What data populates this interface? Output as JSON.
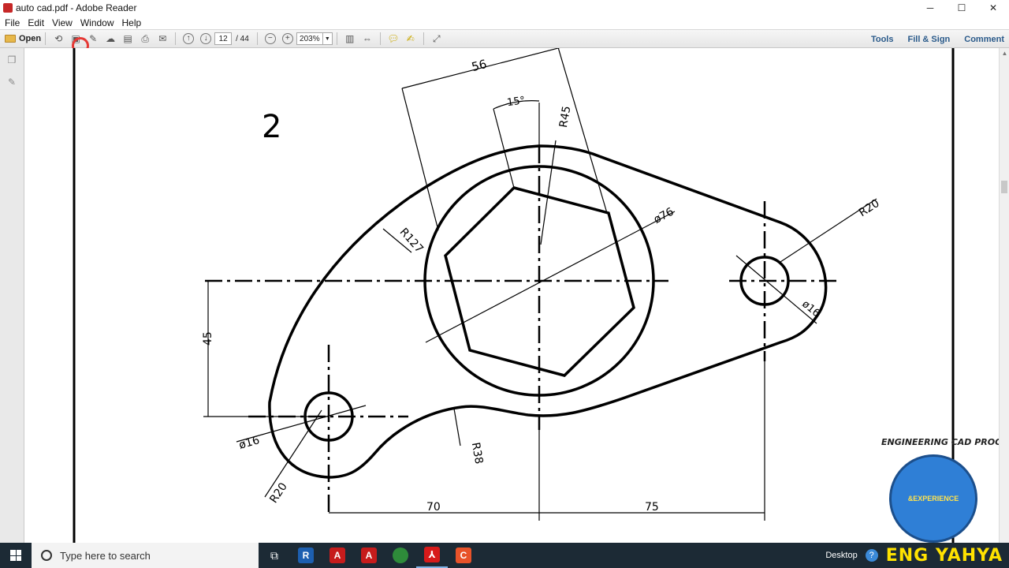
{
  "window": {
    "title": "auto cad.pdf - Adobe Reader",
    "minimize": "─",
    "maximize": "☐",
    "close": "✕"
  },
  "menu": [
    "File",
    "Edit",
    "View",
    "Window",
    "Help"
  ],
  "toolbar": {
    "open_label": "Open",
    "page_current": "12",
    "page_total": "/ 44",
    "zoom": "203%",
    "tools_label": "Tools",
    "fill_sign_label": "Fill & Sign",
    "comment_label": "Comment"
  },
  "drawing": {
    "sheet_number": "2",
    "dimensions": {
      "d56": "56",
      "d15": "15°",
      "r45": "R45",
      "phi76": "ø76",
      "r127": "R127",
      "r20_right": "R20",
      "phi16_right": "ø16",
      "d45": "45",
      "phi16_left": "ø16",
      "r20_left": "R20",
      "r38": "R38",
      "d70": "70",
      "d75": "75"
    }
  },
  "watermark": {
    "text": "ENGINEERING CAD PROGRAMS",
    "badge_text": "&EXPERIENCE"
  },
  "taskbar": {
    "search_placeholder": "Type here to search",
    "desktop_label": "Desktop",
    "brand": "ENG YAHYA"
  },
  "colors": {
    "taskbar_bg": "#1c2a35",
    "accent_link": "#2a5a8a",
    "brand_yellow": "#ffe200",
    "record_red": "#e53935"
  }
}
